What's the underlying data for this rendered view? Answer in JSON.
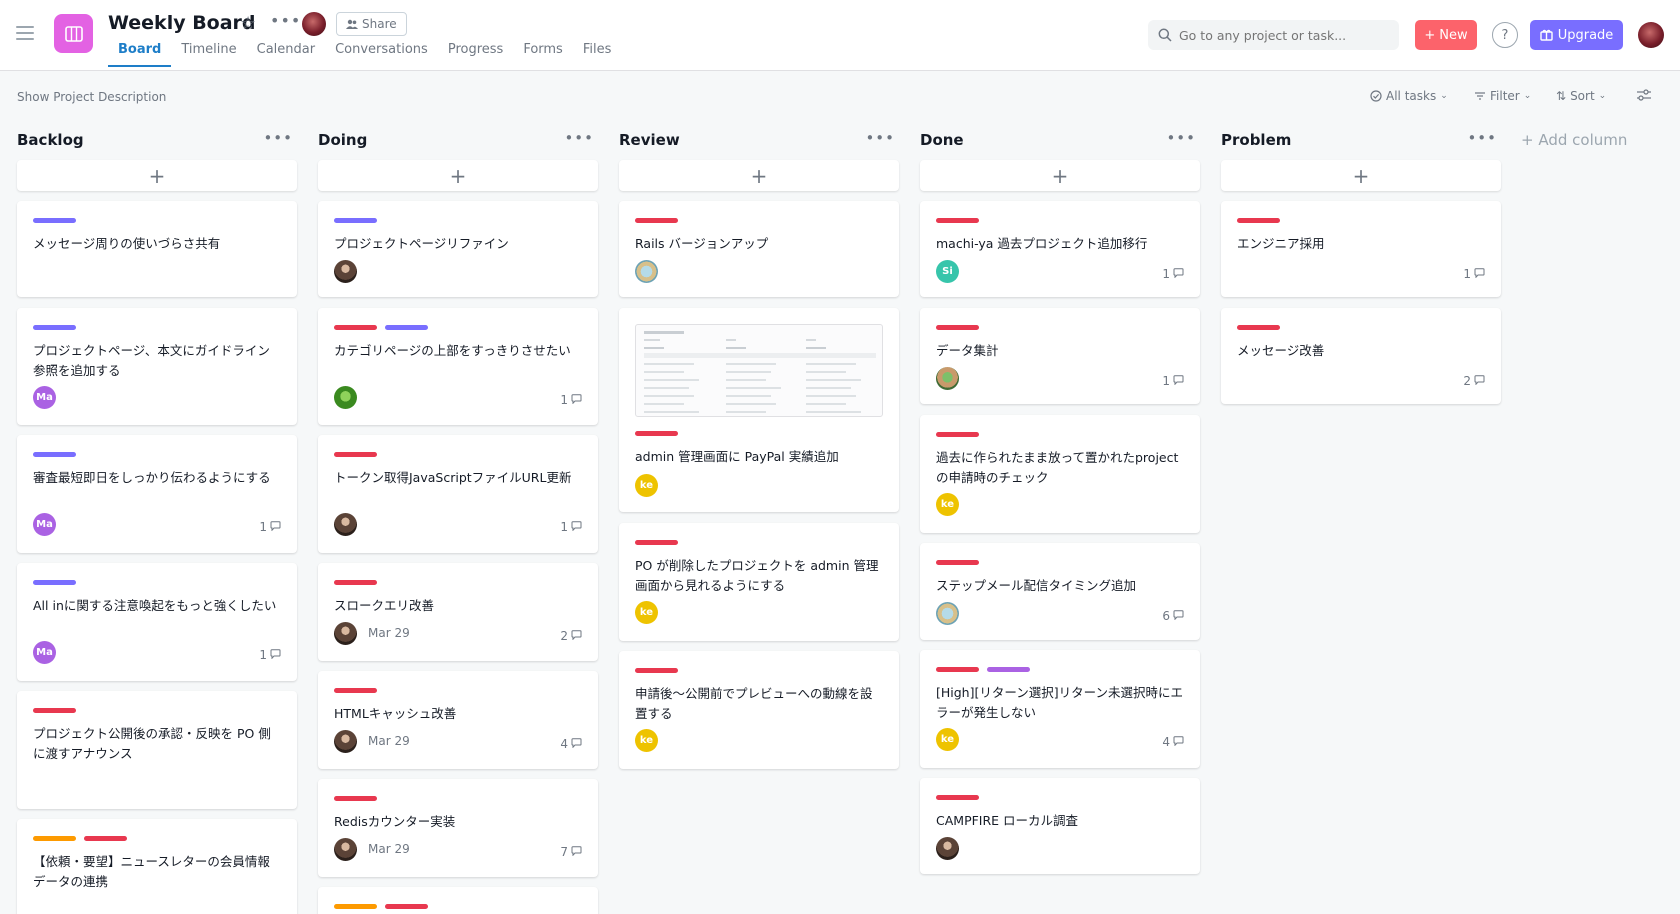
{
  "project": {
    "title": "Weekly Board",
    "share_label": "Share",
    "tabs": [
      "Board",
      "Timeline",
      "Calendar",
      "Conversations",
      "Progress",
      "Forms",
      "Files"
    ],
    "active_tab": "Board"
  },
  "search": {
    "placeholder": "Go to any project or task..."
  },
  "header_actions": {
    "new_label": "New",
    "help_label": "?",
    "upgrade_label": "Upgrade"
  },
  "subbar": {
    "show_description": "Show Project Description",
    "all_tasks": "All tasks",
    "filter": "Filter",
    "sort": "Sort"
  },
  "add_column_label": "+ Add column",
  "colors": {
    "purple_tag": "#796eff",
    "red_tag": "#e8384f",
    "orange_tag": "#fd9a00",
    "lavender_tag": "#aa62e3",
    "new_button": "#fc636b",
    "upgrade_button": "#796eff"
  },
  "columns": [
    {
      "title": "Backlog",
      "cards": [
        {
          "title": "メッセージ周りの使いづらさ共有",
          "tags": [
            "purple"
          ]
        },
        {
          "title": "プロジェクトページ、本文にガイドライン参照を追加する",
          "tags": [
            "purple"
          ],
          "avatar": "Ma"
        },
        {
          "title": "審査最短即日をしっかり伝わるようにする",
          "tags": [
            "purple"
          ],
          "avatar": "Ma",
          "comments": "1"
        },
        {
          "title": "All inに関する注意喚起をもっと強くしたい",
          "tags": [
            "purple"
          ],
          "avatar": "Ma",
          "comments": "1"
        },
        {
          "title": "プロジェクト公開後の承認・反映を PO 側に渡すアナウンス",
          "tags": [
            "red"
          ]
        },
        {
          "title": "【依頼・要望】ニュースレターの会員情報データの連携",
          "tags": [
            "orange",
            "red"
          ]
        }
      ]
    },
    {
      "title": "Doing",
      "cards": [
        {
          "title": "プロジェクトページリファイン",
          "tags": [
            "purple"
          ],
          "avatar": "photo"
        },
        {
          "title": "カテゴリページの上部をすっきりさせたい",
          "tags": [
            "red",
            "purple"
          ],
          "avatar": "green",
          "comments": "1"
        },
        {
          "title": "トークン取得JavaScriptファイルURL更新",
          "tags": [
            "red"
          ],
          "avatar": "photo",
          "comments": "1"
        },
        {
          "title": "スロークエリ改善",
          "tags": [
            "red"
          ],
          "avatar": "photo",
          "date": "Mar 29",
          "comments": "2"
        },
        {
          "title": "HTMLキャッシュ改善",
          "tags": [
            "red"
          ],
          "avatar": "photo",
          "date": "Mar 29",
          "comments": "4"
        },
        {
          "title": "Redisカウンター実装",
          "tags": [
            "red"
          ],
          "avatar": "photo",
          "date": "Mar 29",
          "comments": "7"
        },
        {
          "title": "",
          "tags": [
            "orange",
            "red"
          ]
        }
      ]
    },
    {
      "title": "Review",
      "cards": [
        {
          "title": "Rails バージョンアップ",
          "tags": [
            "red"
          ],
          "avatar": "kids"
        },
        {
          "title": "admin 管理画面に PayPal 実績追加",
          "tags": [
            "red"
          ],
          "avatar": "ke",
          "thumbnail": true
        },
        {
          "title": "PO が削除したプロジェクトを admin 管理画面から見れるようにする",
          "tags": [
            "red"
          ],
          "avatar": "ke"
        },
        {
          "title": "申請後〜公開前でプレビューへの動線を設置する",
          "tags": [
            "red"
          ],
          "avatar": "ke"
        }
      ]
    },
    {
      "title": "Done",
      "cards": [
        {
          "title": "machi-ya 過去プロジェクト追加移行",
          "tags": [
            "red"
          ],
          "avatar": "Si",
          "comments": "1"
        },
        {
          "title": "データ集計",
          "tags": [
            "red"
          ],
          "avatar": "boys",
          "comments": "1"
        },
        {
          "title": "過去に作られたまま放って置かれたprojectの申請時のチェック",
          "tags": [
            "red"
          ],
          "avatar": "ke"
        },
        {
          "title": "ステップメール配信タイミング追加",
          "tags": [
            "red"
          ],
          "avatar": "kids",
          "comments": "6"
        },
        {
          "title": "[High][リターン選択]リターン未選択時にエラーが発生しない",
          "tags": [
            "red",
            "lavender"
          ],
          "avatar": "ke",
          "comments": "4"
        },
        {
          "title": "CAMPFIRE ローカル調査",
          "tags": [
            "red"
          ],
          "avatar": "photo"
        }
      ]
    },
    {
      "title": "Problem",
      "cards": [
        {
          "title": "エンジニア採用",
          "tags": [
            "red"
          ],
          "comments": "1"
        },
        {
          "title": "メッセージ改善",
          "tags": [
            "red"
          ],
          "comments": "2"
        }
      ]
    }
  ]
}
